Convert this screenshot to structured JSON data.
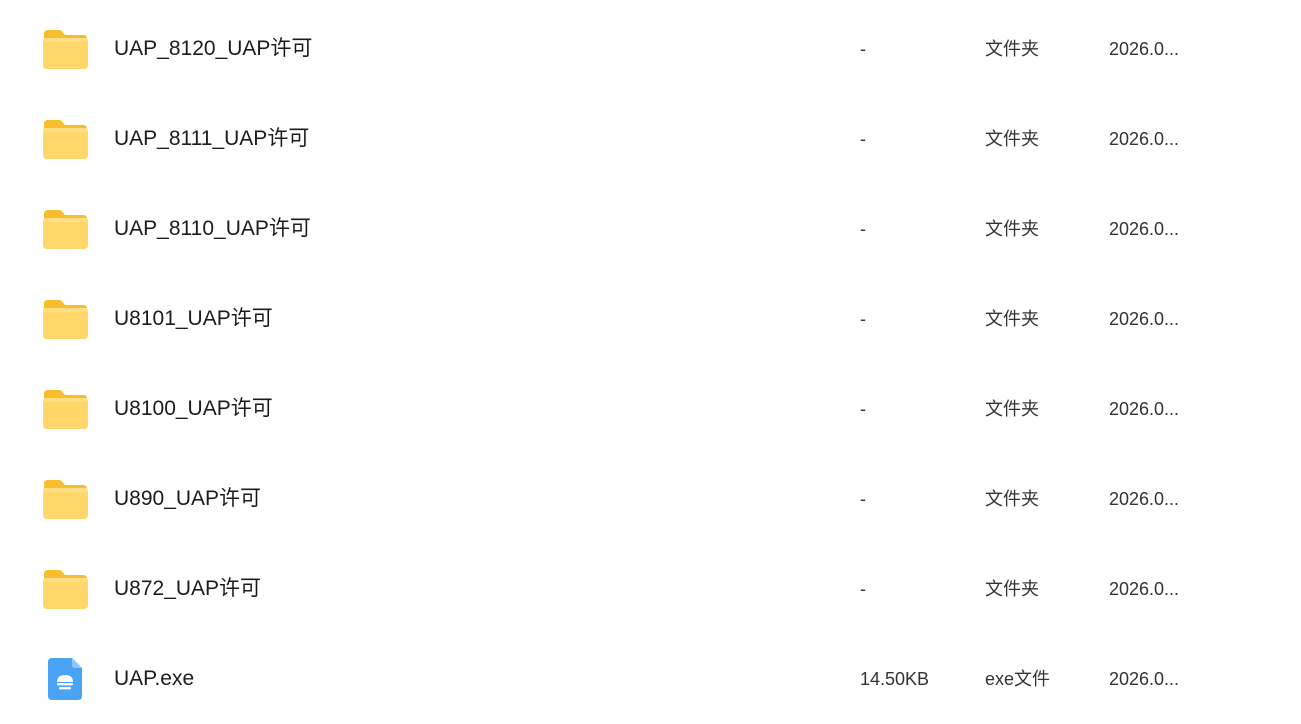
{
  "files": [
    {
      "name": "UAP_8120_UAP许可",
      "size": "-",
      "type": "文件夹",
      "date": "2026.0...",
      "icon": "folder-icon"
    },
    {
      "name": "UAP_8111_UAP许可",
      "size": "-",
      "type": "文件夹",
      "date": "2026.0...",
      "icon": "folder-icon"
    },
    {
      "name": "UAP_8110_UAP许可",
      "size": "-",
      "type": "文件夹",
      "date": "2026.0...",
      "icon": "folder-icon"
    },
    {
      "name": "U8101_UAP许可",
      "size": "-",
      "type": "文件夹",
      "date": "2026.0...",
      "icon": "folder-icon"
    },
    {
      "name": "U8100_UAP许可",
      "size": "-",
      "type": "文件夹",
      "date": "2026.0...",
      "icon": "folder-icon"
    },
    {
      "name": "U890_UAP许可",
      "size": "-",
      "type": "文件夹",
      "date": "2026.0...",
      "icon": "folder-icon"
    },
    {
      "name": "U872_UAP许可",
      "size": "-",
      "type": "文件夹",
      "date": "2026.0...",
      "icon": "folder-icon"
    },
    {
      "name": "UAP.exe",
      "size": "14.50KB",
      "type": "exe文件",
      "date": "2026.0...",
      "icon": "exe-file-icon"
    }
  ],
  "colors": {
    "folder_back": "#f9c53a",
    "folder_front": "#ffdb7a",
    "exe_icon": "#4aa3f5"
  }
}
